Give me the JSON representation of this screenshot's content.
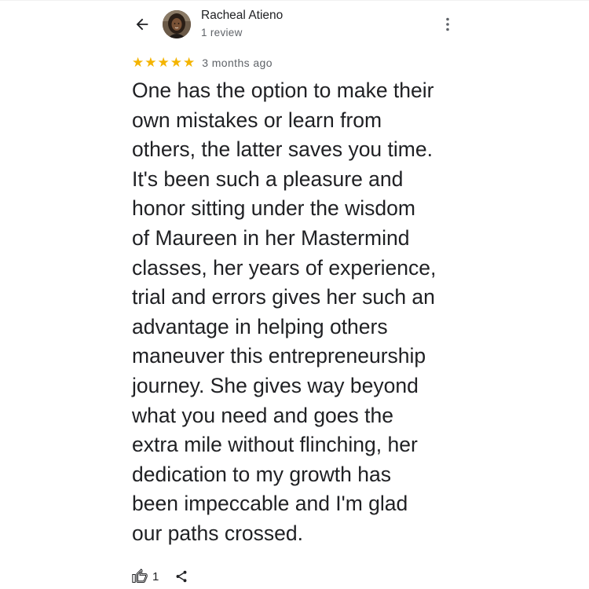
{
  "reviewer": {
    "name": "Racheal Atieno",
    "review_count": "1 review"
  },
  "icons": {
    "back": "arrow-back-icon",
    "more": "more-vert-icon",
    "like": "thumb-up-icon",
    "share": "share-icon"
  },
  "review": {
    "rating": 5,
    "time_ago": "3 months ago",
    "lines": [
      "One has the option to make their",
      "own mistakes or learn from",
      "others, the latter saves you time.",
      "It's been such a pleasure and",
      "honor sitting under the wisdom",
      "of Maureen in her Mastermind",
      "classes, her years of experience,",
      "trial and errors gives her such an",
      "advantage in helping others",
      "maneuver this entrepreneurship",
      "journey. She gives way beyond",
      "what you need and goes the",
      "extra mile without flinching, her",
      "dedication to my growth has",
      "been impeccable and I'm glad",
      "our paths crossed."
    ]
  },
  "actions": {
    "like_count": "1"
  },
  "colors": {
    "star": "#f4b400",
    "text_primary": "#202124",
    "text_secondary": "#5f6368"
  }
}
